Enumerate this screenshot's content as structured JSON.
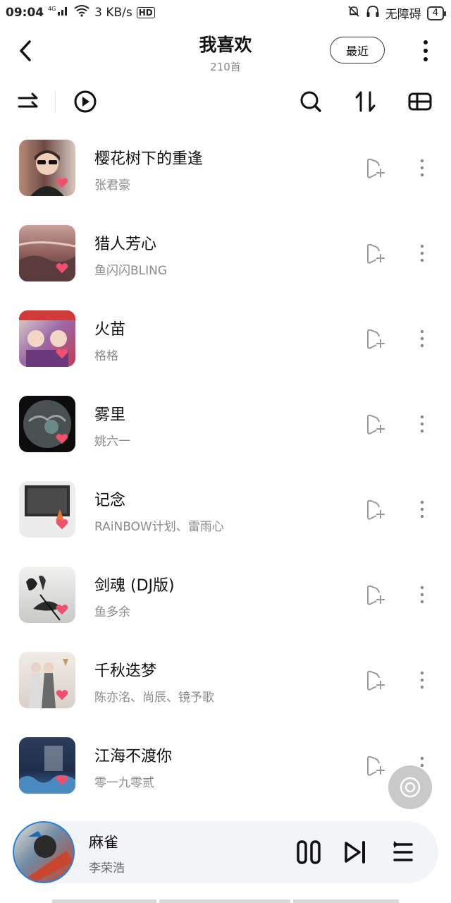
{
  "status_bar": {
    "time": "09:04",
    "network": "4G",
    "speed": "3 KB/s",
    "hd": "HD",
    "accessibility": "无障碍",
    "battery": "4"
  },
  "header": {
    "title": "我喜欢",
    "count": "210首",
    "recent_label": "最近"
  },
  "toolbar": {
    "icons": [
      "shuffle-icon",
      "play-all-icon",
      "search-icon",
      "sort-icon",
      "view-toggle-icon"
    ]
  },
  "songs": [
    {
      "title": "樱花树下的重逢",
      "artist": "张君豪",
      "liked": true
    },
    {
      "title": "猎人芳心",
      "artist": "鱼闪闪BLING",
      "liked": true
    },
    {
      "title": "火苗",
      "artist": "格格",
      "liked": true
    },
    {
      "title": "雾里",
      "artist": "姚六一",
      "liked": true
    },
    {
      "title": "记念",
      "artist": "RAiNBOW计划、雷雨心",
      "liked": true
    },
    {
      "title": "剑魂 (DJ版)",
      "artist": "鱼多余",
      "liked": true
    },
    {
      "title": "千秋迭梦",
      "artist": "陈亦洺、尚辰、镜予歌",
      "liked": true
    },
    {
      "title": "江海不渡你",
      "artist": "零一九零贰",
      "liked": true
    }
  ],
  "now_playing": {
    "title": "麻雀",
    "artist": "李荣浩",
    "state": "playing"
  },
  "colors": {
    "heart": "#f0506e",
    "text_primary": "#111111",
    "text_secondary": "#8a8a8a",
    "player_bg": "#f3f4f7"
  }
}
